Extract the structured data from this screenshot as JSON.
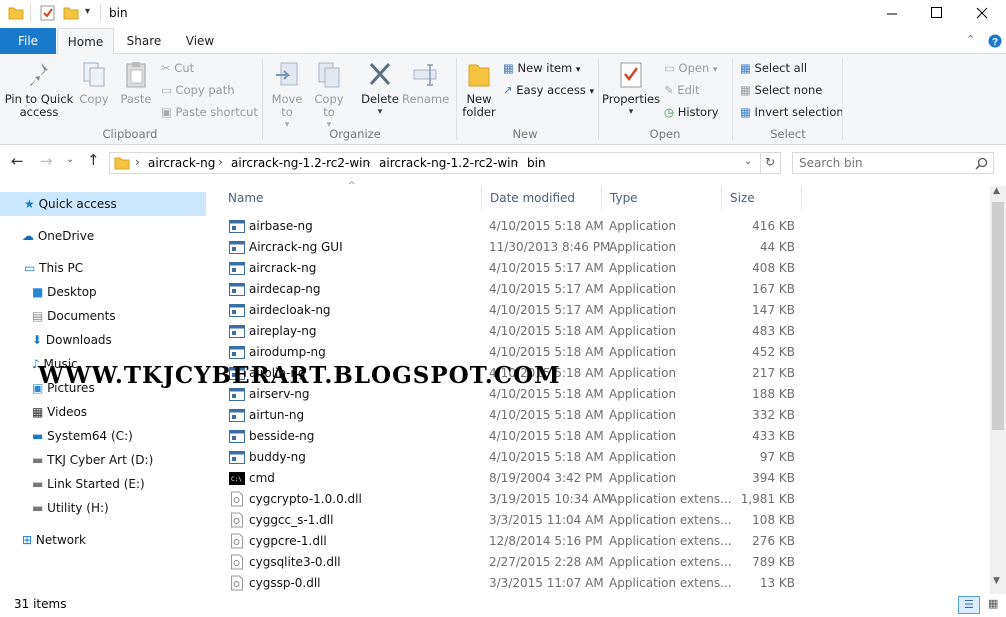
{
  "window": {
    "title": "bin"
  },
  "tabs": {
    "file": "File",
    "home": "Home",
    "share": "Share",
    "view": "View"
  },
  "ribbon": {
    "clipboard": {
      "label": "Clipboard",
      "pin": "Pin to Quick access",
      "copy": "Copy",
      "paste": "Paste",
      "cut": "Cut",
      "copy_path": "Copy path",
      "paste_shortcut": "Paste shortcut"
    },
    "organize": {
      "label": "Organize",
      "move_to": "Move to",
      "copy_to": "Copy to",
      "delete": "Delete",
      "rename": "Rename"
    },
    "new": {
      "label": "New",
      "new_folder": "New folder",
      "new_item": "New item",
      "easy_access": "Easy access"
    },
    "open": {
      "label": "Open",
      "properties": "Properties",
      "open": "Open",
      "edit": "Edit",
      "history": "History"
    },
    "select": {
      "label": "Select",
      "select_all": "Select all",
      "select_none": "Select none",
      "invert": "Invert selection"
    }
  },
  "address": {
    "crumbs": [
      "aircrack-ng",
      "aircrack-ng-1.2-rc2-win",
      "aircrack-ng-1.2-rc2-win",
      "bin"
    ],
    "search_placeholder": "Search bin"
  },
  "nav": {
    "quick_access": "Quick access",
    "onedrive": "OneDrive",
    "this_pc": "This PC",
    "desktop": "Desktop",
    "documents": "Documents",
    "downloads": "Downloads",
    "music": "Music",
    "pictures": "Pictures",
    "videos": "Videos",
    "system64": "System64 (C:)",
    "tkj": "TKJ Cyber Art (D:)",
    "link_started": "Link Started (E:)",
    "utility": "Utility (H:)",
    "network": "Network"
  },
  "columns": {
    "name": "Name",
    "date": "Date modified",
    "type": "Type",
    "size": "Size"
  },
  "files": [
    {
      "name": "airbase-ng",
      "date": "4/10/2015 5:18 AM",
      "type": "Application",
      "size": "416 KB",
      "icon": "app"
    },
    {
      "name": "Aircrack-ng GUI",
      "date": "11/30/2013 8:46 PM",
      "type": "Application",
      "size": "44 KB",
      "icon": "app"
    },
    {
      "name": "aircrack-ng",
      "date": "4/10/2015 5:17 AM",
      "type": "Application",
      "size": "408 KB",
      "icon": "app"
    },
    {
      "name": "airdecap-ng",
      "date": "4/10/2015 5:17 AM",
      "type": "Application",
      "size": "167 KB",
      "icon": "app"
    },
    {
      "name": "airdecloak-ng",
      "date": "4/10/2015 5:17 AM",
      "type": "Application",
      "size": "147 KB",
      "icon": "app"
    },
    {
      "name": "aireplay-ng",
      "date": "4/10/2015 5:18 AM",
      "type": "Application",
      "size": "483 KB",
      "icon": "app"
    },
    {
      "name": "airodump-ng",
      "date": "4/10/2015 5:18 AM",
      "type": "Application",
      "size": "452 KB",
      "icon": "app"
    },
    {
      "name": "airolib-ng",
      "date": "4/10/2015 5:18 AM",
      "type": "Application",
      "size": "217 KB",
      "icon": "app"
    },
    {
      "name": "airserv-ng",
      "date": "4/10/2015 5:18 AM",
      "type": "Application",
      "size": "188 KB",
      "icon": "app"
    },
    {
      "name": "airtun-ng",
      "date": "4/10/2015 5:18 AM",
      "type": "Application",
      "size": "332 KB",
      "icon": "app"
    },
    {
      "name": "besside-ng",
      "date": "4/10/2015 5:18 AM",
      "type": "Application",
      "size": "433 KB",
      "icon": "app"
    },
    {
      "name": "buddy-ng",
      "date": "4/10/2015 5:18 AM",
      "type": "Application",
      "size": "97 KB",
      "icon": "app"
    },
    {
      "name": "cmd",
      "date": "8/19/2004 3:42 PM",
      "type": "Application",
      "size": "394 KB",
      "icon": "cmd"
    },
    {
      "name": "cygcrypto-1.0.0.dll",
      "date": "3/19/2015 10:34 AM",
      "type": "Application extens...",
      "size": "1,981 KB",
      "icon": "dll"
    },
    {
      "name": "cyggcc_s-1.dll",
      "date": "3/3/2015 11:04 AM",
      "type": "Application extens...",
      "size": "108 KB",
      "icon": "dll"
    },
    {
      "name": "cygpcre-1.dll",
      "date": "12/8/2014 5:16 PM",
      "type": "Application extens...",
      "size": "276 KB",
      "icon": "dll"
    },
    {
      "name": "cygsqlite3-0.dll",
      "date": "2/27/2015 2:28 AM",
      "type": "Application extens...",
      "size": "789 KB",
      "icon": "dll"
    },
    {
      "name": "cygssp-0.dll",
      "date": "3/3/2015 11:07 AM",
      "type": "Application extens...",
      "size": "13 KB",
      "icon": "dll"
    }
  ],
  "status": {
    "item_count": "31 items"
  },
  "watermark": "WWW.TKJCYBERART.BLOGSPOT.COM",
  "colors": {
    "accent": "#1979ca",
    "selected_nav": "#cce8ff",
    "header_text": "#4c607a"
  }
}
